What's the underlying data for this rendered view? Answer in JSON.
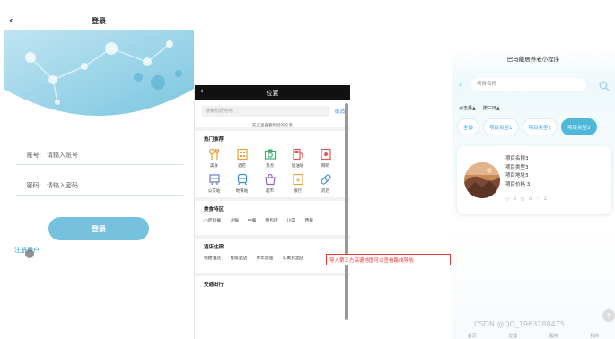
{
  "login": {
    "title": "登录",
    "account_label": "账号:",
    "account_placeholder": "请输入账号",
    "password_label": "密码:",
    "password_placeholder": "请输入密码",
    "login_button": "登录",
    "register_link": "注册用户"
  },
  "location": {
    "title": "位置",
    "search_placeholder": "搜索附近地点",
    "cancel": "取消",
    "hint": "在这里查看附近的信息",
    "hot": {
      "title": "热门推荐",
      "items": [
        {
          "label": "美食",
          "icon": "food-icon"
        },
        {
          "label": "酒店",
          "icon": "hotel-icon"
        },
        {
          "label": "景点",
          "icon": "camera-icon"
        },
        {
          "label": "加油站",
          "icon": "gas-station-icon"
        },
        {
          "label": "网吧",
          "icon": "monitor-icon"
        },
        {
          "label": "公交站",
          "icon": "bus-stop-icon"
        },
        {
          "label": "地铁站",
          "icon": "subway-icon"
        },
        {
          "label": "超市",
          "icon": "shopping-icon"
        },
        {
          "label": "银行",
          "icon": "bank-icon"
        },
        {
          "label": "药店",
          "icon": "pill-icon"
        }
      ]
    },
    "food": {
      "title": "美食特区",
      "items": [
        "小吃快餐",
        "火锅",
        "中餐",
        "面包店",
        "川菜",
        "西餐"
      ]
    },
    "hotel": {
      "title": "酒店住宿",
      "items": [
        "快捷酒店",
        "星级酒店",
        "青年旅舍",
        "公寓式酒店"
      ]
    },
    "traffic": {
      "title": "交通出行"
    }
  },
  "annotation": "导入第三方高德地图可以查看路线导航",
  "projects": {
    "title": "巴马能居养老小程序",
    "search_placeholder": "项目名称",
    "sort": [
      "点击量▲",
      "按三环▲"
    ],
    "tabs": [
      {
        "label": "全部",
        "active": false
      },
      {
        "label": "项目类型1",
        "active": false
      },
      {
        "label": "项目类型2",
        "active": false
      },
      {
        "label": "项目类型3",
        "active": true
      }
    ],
    "card": {
      "name": "项目名称3",
      "type": "项目类型3",
      "address": "项目地址3",
      "price": "项目价格 3",
      "meta": [
        "3",
        "0",
        "2"
      ]
    },
    "watermark": "CSDN @QQ_1963288475",
    "bottom": [
      "首页",
      "位置",
      "服务",
      "我的"
    ]
  },
  "colors": {
    "accent": "#76c2de",
    "tab_active": "#4fb8d8",
    "link": "#2b9fd8",
    "annotation": "#e33333"
  }
}
